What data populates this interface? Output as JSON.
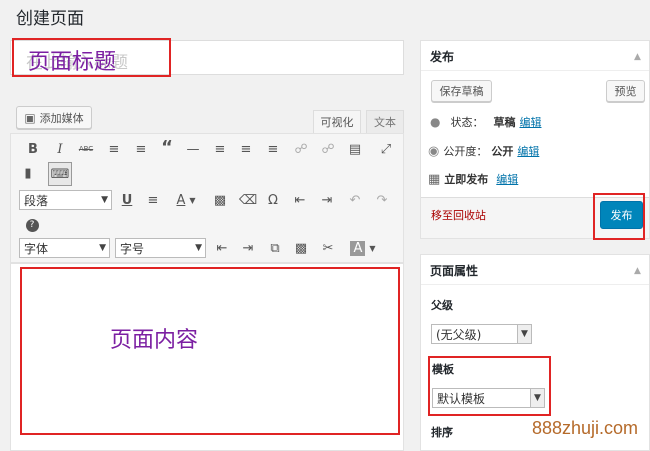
{
  "page": {
    "title": "创建页面"
  },
  "title_field": {
    "placeholder": "在此输入标题",
    "overlay": "页面标题"
  },
  "editor": {
    "add_media": "添加媒体",
    "tabs": {
      "visual": "可视化",
      "text": "文本"
    },
    "format_select": "段落",
    "font_family_select": "字体",
    "font_size_select": "字号",
    "content_overlay": "页面内容",
    "font_color_letter": "A",
    "toolbar_icons": [
      "bold-icon",
      "italic-icon",
      "strikethrough-icon",
      "bullet-list-icon",
      "numbered-list-icon",
      "blockquote-icon",
      "horizontal-rule-icon",
      "align-left-icon",
      "align-center-icon",
      "align-right-icon",
      "link-icon",
      "unlink-icon",
      "read-more-icon",
      "fullscreen-icon",
      "toolbar-toggle-icon",
      "keyboard-icon",
      "underline-icon",
      "justify-icon",
      "text-color-icon",
      "paste-text-icon",
      "clear-formatting-icon",
      "omega-icon",
      "outdent-icon",
      "indent-icon",
      "undo-icon",
      "redo-icon",
      "help-icon"
    ]
  },
  "publish_box": {
    "title": "发布",
    "save_draft": "保存草稿",
    "preview": "预览",
    "status_label": "状态：",
    "status_value": "草稿",
    "visibility_label": "公开度：",
    "visibility_value": "公开",
    "schedule_label": "立即发布",
    "edit": "编辑",
    "trash": "移至回收站",
    "publish": "发布"
  },
  "attributes_box": {
    "title": "页面属性",
    "parent_label": "父级",
    "parent_value": "(无父级)",
    "template_label": "模板",
    "template_value": "默认模板",
    "order_label": "排序"
  },
  "watermark": "888zhuji.com",
  "colors": {
    "accent": "#0085ba",
    "annotation_box": "#e02424",
    "annotation_text": "#7b1fa2",
    "trash": "#a00"
  }
}
